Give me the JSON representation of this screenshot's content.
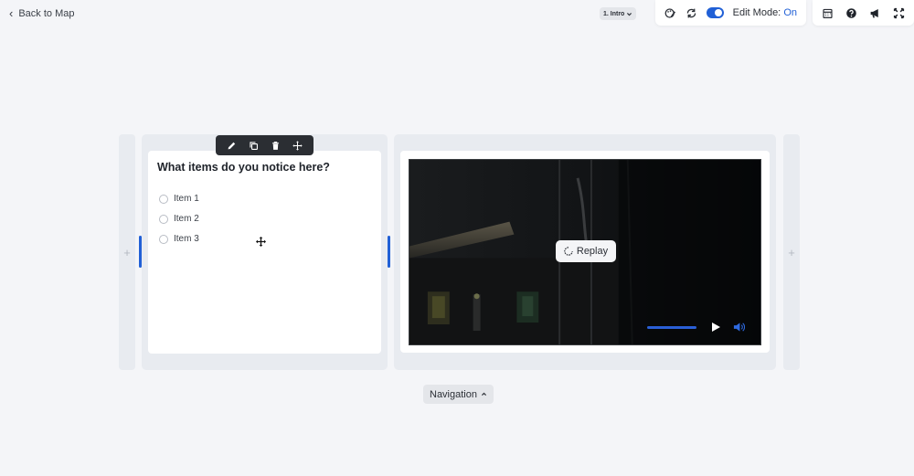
{
  "header": {
    "back_label": "Back to Map",
    "page_selector": "1. Intro",
    "edit_mode_label": "Edit Mode:",
    "edit_mode_value": "On"
  },
  "question": {
    "title": "What items do you notice here?",
    "options": [
      "Item 1",
      "Item 2",
      "Item 3"
    ]
  },
  "video": {
    "replay_label": "Replay",
    "progress": 1.0
  },
  "footer": {
    "navigation_label": "Navigation"
  },
  "colors": {
    "accent": "#2160d6",
    "background": "#f4f5f8",
    "toolbar": "#2b2e33"
  }
}
